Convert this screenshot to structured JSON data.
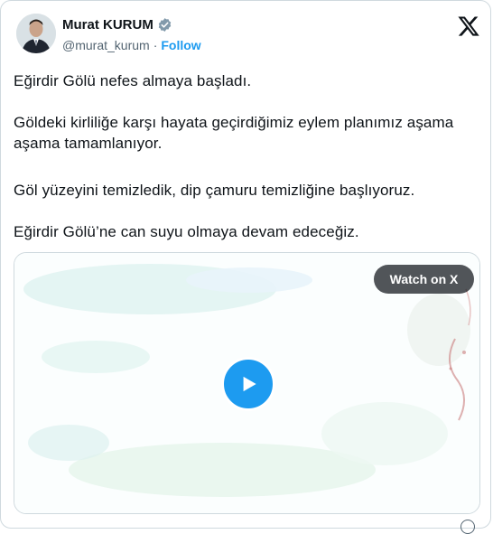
{
  "author": {
    "name": "Murat KURUM",
    "handle": "@murat_kurum",
    "separator": "·",
    "follow_label": "Follow",
    "verified_color": "#829aab"
  },
  "tweet": {
    "paragraphs": [
      "Eğirdir Gölü nefes almaya başladı.",
      "Göldeki kirliliğe karşı hayata geçirdiğimiz eylem planımız aşama aşama tamamlanıyor.",
      "Göl yüzeyini temizledik, dip çamuru temizliğine başlıyoruz.",
      "Eğirdir Gölü’ne can suyu olmaya devam edeceğiz."
    ]
  },
  "media": {
    "watch_label": "Watch on X",
    "play_icon": "play-icon"
  },
  "colors": {
    "accent": "#1d9bf0",
    "secondary_text": "#536471",
    "text": "#0f1419"
  }
}
